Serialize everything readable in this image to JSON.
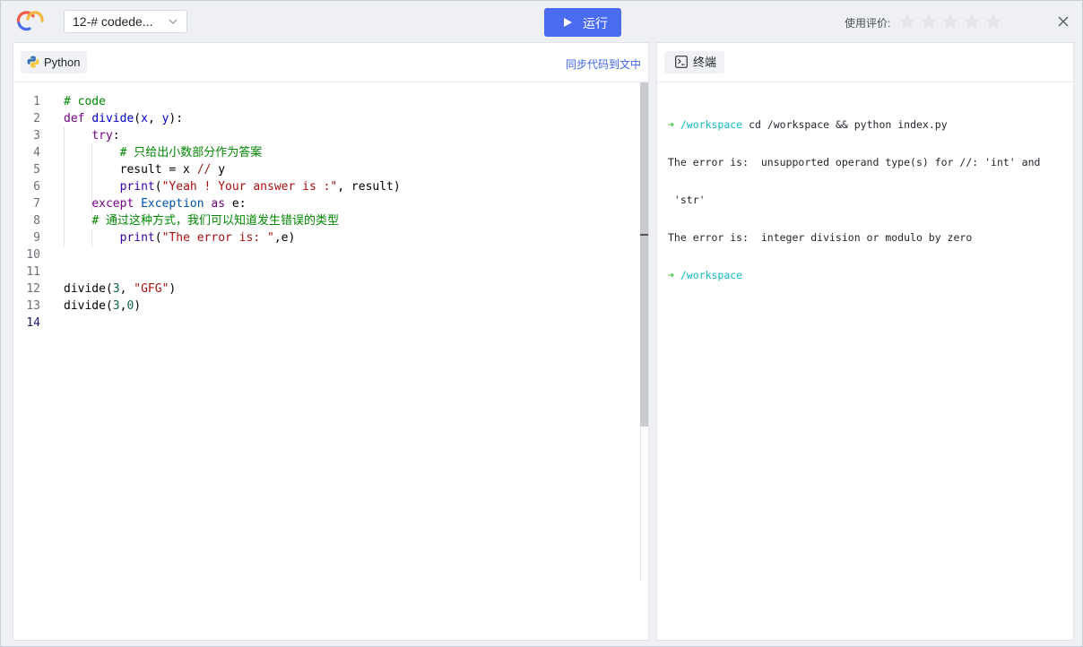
{
  "header": {
    "file_name": "12-# codede...",
    "run_label": "运行",
    "rating_label": "使用评价:",
    "stars_total": 5,
    "stars_filled": 0
  },
  "editor": {
    "language": "Python",
    "sync_label": "同步代码到文中",
    "active_line": 14,
    "lines": [
      {
        "n": "1",
        "tokens": [
          {
            "t": "# code",
            "c": "cmt"
          }
        ]
      },
      {
        "n": "2",
        "tokens": [
          {
            "t": "def ",
            "c": "kw"
          },
          {
            "t": "divide",
            "c": "def2"
          },
          {
            "t": "(",
            "c": "var"
          },
          {
            "t": "x",
            "c": "def2"
          },
          {
            "t": ", ",
            "c": "var"
          },
          {
            "t": "y",
            "c": "def2"
          },
          {
            "t": "):",
            "c": "var"
          }
        ]
      },
      {
        "n": "3",
        "tokens": [
          {
            "t": "    ",
            "c": "var"
          },
          {
            "t": "try",
            "c": "kw"
          },
          {
            "t": ":",
            "c": "var"
          }
        ]
      },
      {
        "n": "4",
        "tokens": [
          {
            "t": "        ",
            "c": "var"
          },
          {
            "t": "# 只给出小数部分作为答案",
            "c": "cmt"
          }
        ]
      },
      {
        "n": "5",
        "tokens": [
          {
            "t": "        result = x ",
            "c": "var"
          },
          {
            "t": "//",
            "c": "op"
          },
          {
            "t": " y",
            "c": "var"
          }
        ]
      },
      {
        "n": "6",
        "tokens": [
          {
            "t": "        ",
            "c": "var"
          },
          {
            "t": "print",
            "c": "builtin"
          },
          {
            "t": "(",
            "c": "var"
          },
          {
            "t": "\"Yeah ! Your answer is :\"",
            "c": "str"
          },
          {
            "t": ", result)",
            "c": "var"
          }
        ]
      },
      {
        "n": "7",
        "tokens": [
          {
            "t": "    ",
            "c": "var"
          },
          {
            "t": "except ",
            "c": "kw"
          },
          {
            "t": "Exception ",
            "c": "cls"
          },
          {
            "t": "as ",
            "c": "kw"
          },
          {
            "t": "e:",
            "c": "var"
          }
        ]
      },
      {
        "n": "8",
        "tokens": [
          {
            "t": "    ",
            "c": "var"
          },
          {
            "t": "# 通过这种方式，我们可以知道发生错误的类型",
            "c": "cmt"
          }
        ]
      },
      {
        "n": "9",
        "tokens": [
          {
            "t": "        ",
            "c": "var"
          },
          {
            "t": "print",
            "c": "builtin"
          },
          {
            "t": "(",
            "c": "var"
          },
          {
            "t": "\"The error is: \"",
            "c": "str"
          },
          {
            "t": ",e)",
            "c": "var"
          }
        ]
      },
      {
        "n": "10",
        "tokens": []
      },
      {
        "n": "11",
        "tokens": []
      },
      {
        "n": "12",
        "tokens": [
          {
            "t": "divide(",
            "c": "var"
          },
          {
            "t": "3",
            "c": "num"
          },
          {
            "t": ", ",
            "c": "var"
          },
          {
            "t": "\"GFG\"",
            "c": "str"
          },
          {
            "t": ")",
            "c": "var"
          }
        ]
      },
      {
        "n": "13",
        "tokens": [
          {
            "t": "divide(",
            "c": "var"
          },
          {
            "t": "3",
            "c": "num"
          },
          {
            "t": ",",
            "c": "var"
          },
          {
            "t": "0",
            "c": "num"
          },
          {
            "t": ")",
            "c": "var"
          }
        ]
      },
      {
        "n": "14",
        "tokens": []
      }
    ]
  },
  "terminal": {
    "title": "终端",
    "prompt_arrow": "➜",
    "prompt_path": "/workspace",
    "command": "cd /workspace && python index.py",
    "output": [
      "The error is:  unsupported operand type(s) for //: 'int' and",
      " 'str'",
      "The error is:  integer division or modulo by zero"
    ]
  },
  "colors": {
    "accent": "#4b6cf0",
    "link": "#3f64e6",
    "prompt_arrow": "#3cc43c",
    "prompt_path": "#12b9c7"
  }
}
